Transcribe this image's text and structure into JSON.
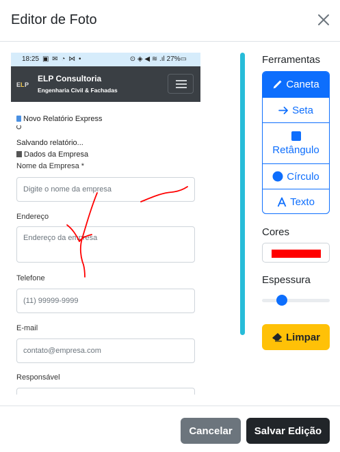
{
  "modal": {
    "title": "Editor de Foto",
    "close_icon": "close-icon"
  },
  "photo": {
    "statusbar": {
      "time": "18:25",
      "notifications": "▣ ✉ ◔ ⋈ •",
      "system": "⊙ ◈ ◀ ≋ .ıl 27%▭"
    },
    "app": {
      "logo": "ELP",
      "brand": "ELP Consultoria",
      "subtitle": "Engenharia Civil & Fachadas"
    },
    "content": {
      "report_title": "Novo Relatório Express",
      "saving_text": "Salvando relatório...",
      "section_title": "Dados da Empresa",
      "company_label": "Nome da Empresa *",
      "company_placeholder": "Digite o nome da empresa",
      "address_label": "Endereço",
      "address_placeholder": "Endereço da empresa",
      "phone_label": "Telefone",
      "phone_placeholder": "(11) 99999-9999",
      "email_label": "E-mail",
      "email_placeholder": "contato@empresa.com",
      "responsible_label": "Responsável"
    },
    "annotation_color": "#ff0000"
  },
  "tools": {
    "heading": "Ferramentas",
    "items": [
      {
        "label": "Caneta",
        "icon": "pencil-icon",
        "active": true
      },
      {
        "label": "Seta",
        "icon": "arrow-right-icon",
        "active": false
      },
      {
        "label": "Retângulo",
        "icon": "square-icon",
        "active": false
      },
      {
        "label": "Círculo",
        "icon": "circle-icon",
        "active": false
      },
      {
        "label": "Texto",
        "icon": "text-icon",
        "active": false
      }
    ],
    "accent_color": "#0d6efd"
  },
  "colors": {
    "heading": "Cores",
    "selected": "#ff0000"
  },
  "thickness": {
    "heading": "Espessura",
    "value_fraction": 0.25
  },
  "clear_button": {
    "label": "Limpar",
    "icon": "eraser-icon",
    "color": "#ffc107"
  },
  "footer": {
    "cancel_label": "Cancelar",
    "save_label": "Salvar Edição"
  }
}
